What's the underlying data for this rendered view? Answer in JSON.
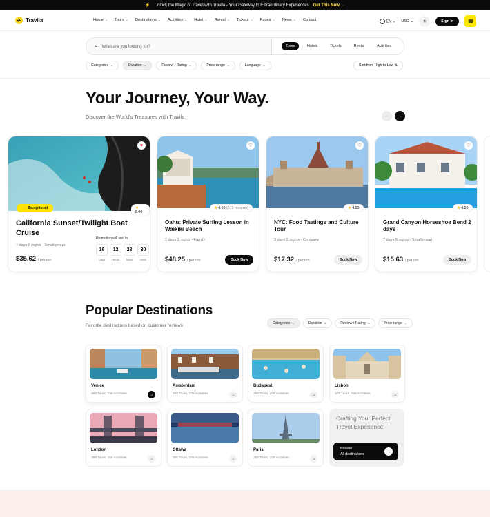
{
  "promo_bar": {
    "text": "Unlock the Magic of Travel with Travila - Your Gateway to Extraordinary Experiences",
    "cta": "Get This Now"
  },
  "brand": {
    "name": "Travila",
    "accent": "#f6d51a"
  },
  "nav": {
    "items": [
      "Home",
      "Tours",
      "Destinations",
      "Activities",
      "Hotel",
      "Rental",
      "Tickets",
      "Pages",
      "News",
      "Contact"
    ],
    "language": "EN",
    "currency": "USD",
    "signin": "Sign in"
  },
  "search": {
    "placeholder": "What are you looking for?",
    "tabs": [
      "Tours",
      "Hotels",
      "Tickets",
      "Rental",
      "Activities"
    ],
    "active_tab": "Tours"
  },
  "filters": [
    "Categories",
    "Duration",
    "Review / Rating",
    "Price range",
    "Language"
  ],
  "sort": "Sort from High to Low",
  "hero": {
    "title": "Your Journey, Your Way.",
    "subtitle": "Discover the World's Treasures with Travila"
  },
  "tours": [
    {
      "title": "California Sunset/Twilight Boat Cruise",
      "meta": "7 days 6 nights - Small group",
      "price": "$35.62",
      "per": "/ person",
      "rating": "5.00",
      "badge": "Exceptional",
      "promo": "Promotion will end in",
      "timer": [
        {
          "v": "16",
          "l": "Days"
        },
        {
          "v": "12",
          "l": "Hours"
        },
        {
          "v": "28",
          "l": "Mins"
        },
        {
          "v": "30",
          "l": "Secs"
        }
      ]
    },
    {
      "title": "Oahu: Private Surfing Lesson in Waikiki Beach",
      "meta": "2 days 3 nights - Family",
      "price": "$48.25",
      "per": "/ person",
      "rating": "4.95",
      "reviews": "(672 reviews)",
      "book": "Book Now"
    },
    {
      "title": "NYC: Food Tastings and Culture Tour",
      "meta": "3 days 3 nights - Company",
      "price": "$17.32",
      "per": "/ person",
      "rating": "4.95",
      "book": "Book Now"
    },
    {
      "title": "Grand Canyon Horseshoe Bend 2 days",
      "meta": "7 days 6 nights - Small group",
      "price": "$15.63",
      "per": "/ person",
      "rating": "4.95",
      "book": "Book Now"
    }
  ],
  "popular": {
    "title": "Popular Destinations",
    "subtitle": "Favorite destinations based on customer reviews",
    "filters": [
      "Categories",
      "Duration",
      "Review / Rating",
      "Price range"
    ],
    "destinations": [
      {
        "name": "Venice",
        "meta": "356 Tours,  248 Activities"
      },
      {
        "name": "Amsterdam",
        "meta": "356 Tours,  248 Activities"
      },
      {
        "name": "Budapest",
        "meta": "356 Tours,  248 Activities"
      },
      {
        "name": "Lisbon",
        "meta": "356 Tours,  248 Activities"
      },
      {
        "name": "London",
        "meta": "356 Tours,  248 Activities"
      },
      {
        "name": "Ottawa",
        "meta": "356 Tours,  248 Activities"
      },
      {
        "name": "Paris",
        "meta": "356 Tours,  248 Activities"
      }
    ],
    "craft": {
      "title": "Crafting Your Perfect Travel Experience",
      "browse_1": "Browse",
      "browse_2": "All destinations"
    }
  }
}
